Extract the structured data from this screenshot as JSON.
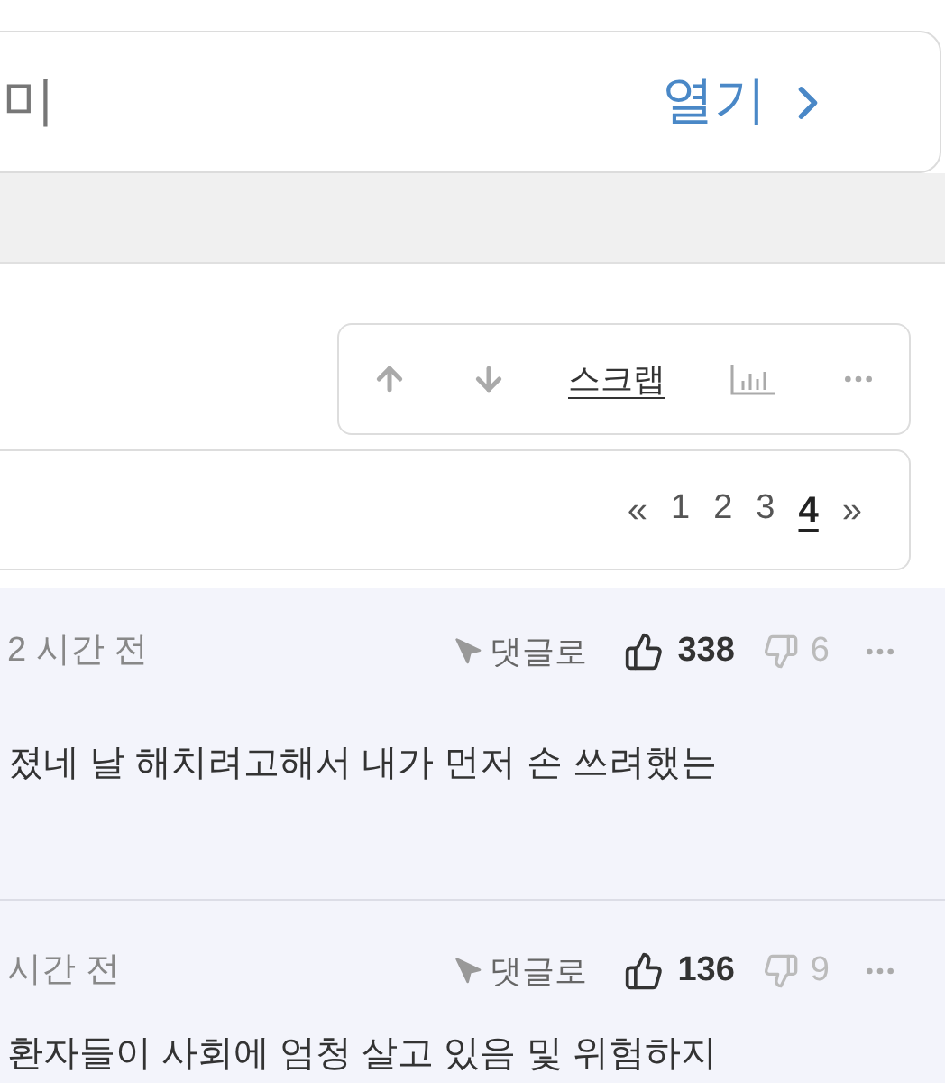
{
  "board_card": {
    "title": "미",
    "open_label": "열기"
  },
  "post_actions": {
    "scrap_label": "스크랩"
  },
  "pagination": {
    "first": "«",
    "pages": [
      {
        "label": "1",
        "selected": false
      },
      {
        "label": "2",
        "selected": false
      },
      {
        "label": "3",
        "selected": false
      },
      {
        "label": "4",
        "selected": true
      }
    ],
    "last": "»"
  },
  "comments": [
    {
      "time": "2 시간 전",
      "reply_label": "댓글로",
      "likes": "338",
      "dislikes": "6",
      "text": "졌네 날 해치려고해서 내가 먼저 손 쓰려했는"
    },
    {
      "time": "시간 전",
      "reply_label": "댓글로",
      "likes": "136",
      "dislikes": "9",
      "text": "환자들이 사회에 엄청 살고 있음 및 위험하지"
    }
  ]
}
